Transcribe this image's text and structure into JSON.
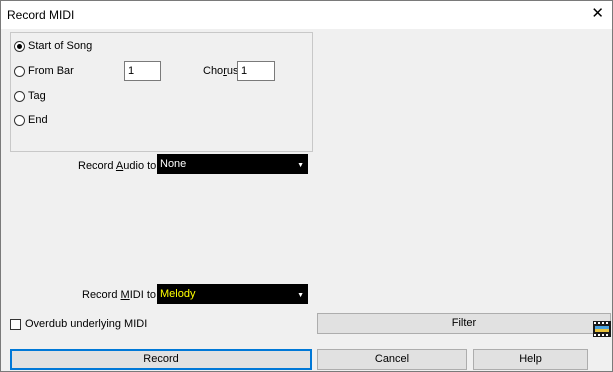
{
  "window": {
    "title": "Record MIDI",
    "close_glyph": "✕"
  },
  "start_options": {
    "items": [
      {
        "label": "Start of Song",
        "checked": true
      },
      {
        "label": "From Bar",
        "checked": false
      },
      {
        "label": "Tag",
        "checked": false
      },
      {
        "label": "End",
        "checked": false
      }
    ],
    "from_bar_value": "1",
    "chorus_label_pre": "Cho",
    "chorus_label_u": "r",
    "chorus_label_post": "us",
    "chorus_value": "1"
  },
  "record_audio": {
    "label_pre": "Record ",
    "label_u": "A",
    "label_post": "udio to:",
    "value": "None"
  },
  "record_midi": {
    "label_pre": "Record ",
    "label_u": "M",
    "label_post": "IDI to:",
    "value": "Melody",
    "value_color": "#ffff00"
  },
  "overdub": {
    "label": "Overdub underlying MIDI",
    "checked": false
  },
  "buttons": {
    "filter": "Filter",
    "record": "Record",
    "cancel": "Cancel",
    "help": "Help"
  },
  "icons": {
    "close": "close-icon",
    "video": "film-icon"
  }
}
